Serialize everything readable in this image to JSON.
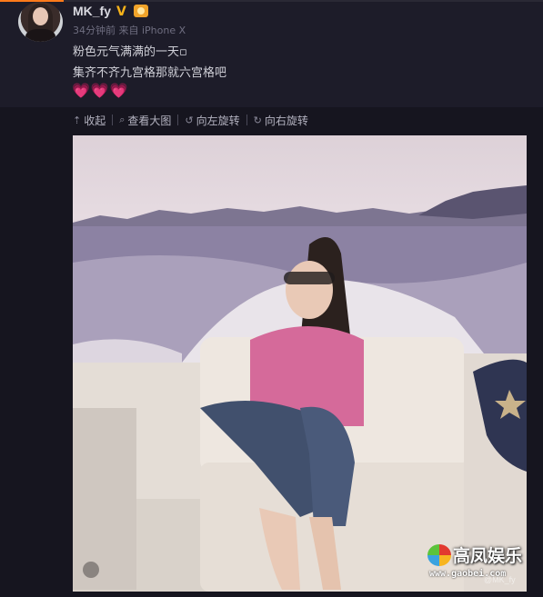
{
  "post": {
    "username": "MK_fy",
    "verified_mark": "V",
    "meta": "34分钟前 来自 iPhone X",
    "text_line1": "粉色元气满满的一天▫",
    "text_line2": "集齐不齐九宫格那就六宫格吧",
    "hearts": "💗💗💗"
  },
  "toolbar": {
    "collapse_icon": "arrow-up-icon",
    "collapse_label": "收起",
    "view_large_icon": "magnifier-icon",
    "view_large_label": "查看大图",
    "rotate_left_icon": "rotate-left-icon",
    "rotate_left_label": "向左旋转",
    "rotate_right_icon": "rotate-right-icon",
    "rotate_right_label": "向右旋转"
  },
  "watermark": {
    "title": "高凤娱乐",
    "url": "www.gaobei.com",
    "credit": "@MK_fy"
  },
  "colors": {
    "accent": "#ff7a1a",
    "background": "#16151f",
    "header_bg": "#1d1c29"
  }
}
